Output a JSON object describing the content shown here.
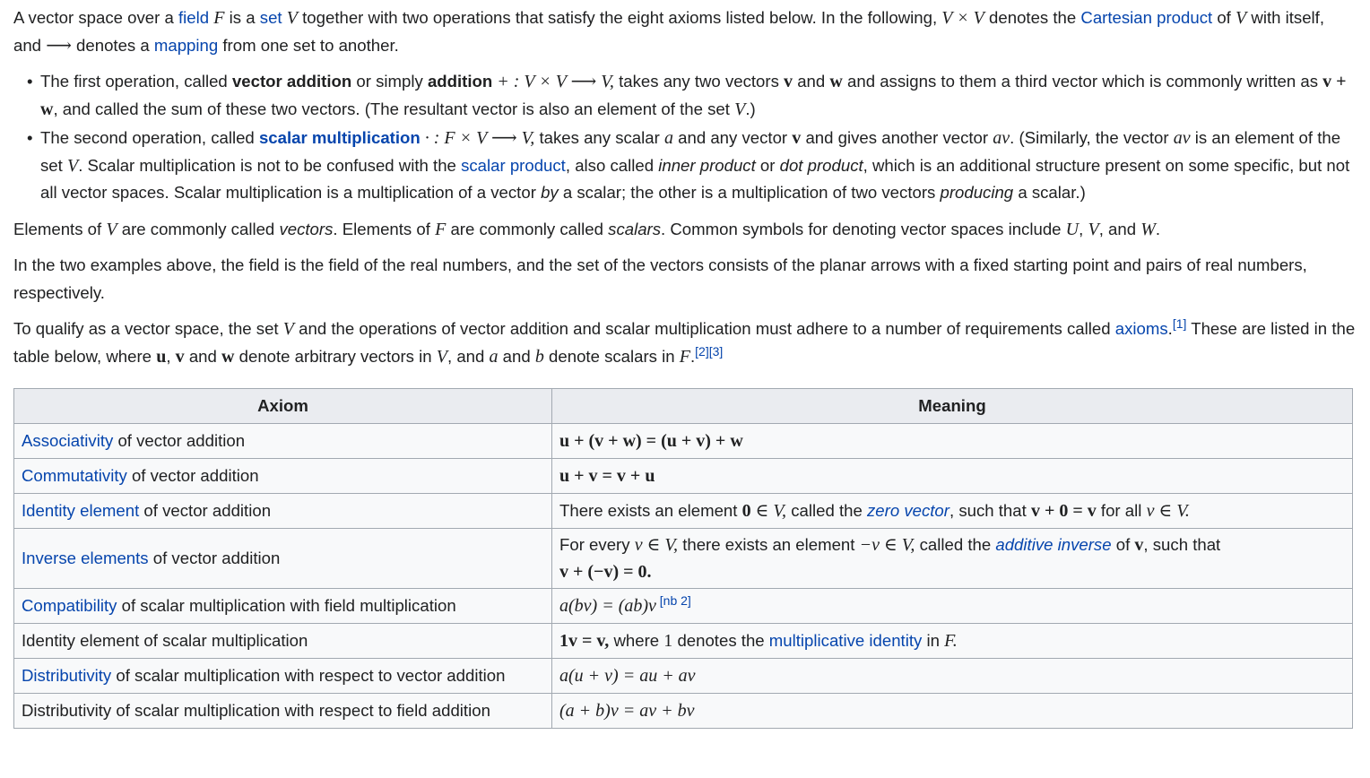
{
  "intro": {
    "t1": "A vector space over a ",
    "field_link": "field",
    "t2": " ",
    "F": "F",
    "t3": " is a ",
    "set_link": "set",
    "t4": " ",
    "V": "V",
    "t5": " together with two operations that satisfy the eight axioms listed below. In the following, ",
    "VxV": "V × V",
    "t6": " denotes the ",
    "cartesian_link": "Cartesian product",
    "t7": " of ",
    "V2": "V",
    "t8": " with itself, and ",
    "arrow": "⟶",
    "t9": " denotes a ",
    "mapping_link": "mapping",
    "t10": " from one set to another."
  },
  "bullets": {
    "first": {
      "t1": "The first operation, called ",
      "bold1": "vector addition",
      "t2": " or simply ",
      "bold2": "addition",
      "math1": " + : V × V ⟶ V,",
      "t3": " takes any two vectors ",
      "v": "v",
      "t4": " and ",
      "w": "w",
      "t5": " and assigns to them a third vector which is commonly written as ",
      "vw": "v + w",
      "t6": ", and called the sum of these two vectors. (The resultant vector is also an element of the set ",
      "V": "V",
      "t7": ".)"
    },
    "second": {
      "t1": "The second operation, called ",
      "bold_link": "scalar multiplication",
      "math1": " · : F × V ⟶ V,",
      "t2": "  takes any scalar ",
      "a": "a",
      "t3": " and any vector ",
      "v": "v",
      "t4": " and gives another vector ",
      "av": "av",
      "t5": ". (Similarly, the vector ",
      "av2": "av",
      "t6": " is an element of the set ",
      "V": "V",
      "t7": ". Scalar multiplication is not to be confused with the ",
      "scalar_product_link": "scalar product",
      "t8": ", also called ",
      "inner": "inner product",
      "t9": " or ",
      "dot": "dot product",
      "t10": ", which is an additional structure present on some specific, but not all vector spaces. Scalar multiplication is a multiplication of a vector ",
      "by": "by",
      "t11": " a scalar; the other is a multiplication of two vectors ",
      "producing": "producing",
      "t12": " a scalar.)"
    }
  },
  "para_elements": {
    "t1": "Elements of ",
    "V": "V",
    "t2": " are commonly called ",
    "vectors": "vectors",
    "t3": ". Elements of ",
    "F": "F",
    "t4": " are commonly called ",
    "scalars": "scalars",
    "t5": ". Common symbols for denoting vector spaces include ",
    "U": "U",
    "t6": ", ",
    "V2": "V",
    "t7": ", and ",
    "W": "W",
    "t8": "."
  },
  "para_examples": {
    "text": "In the two examples above, the field is the field of the real numbers, and the set of the vectors consists of the planar arrows with a fixed starting point and pairs of real numbers, respectively."
  },
  "para_qualify": {
    "t1": "To qualify as a vector space, the set ",
    "V": "V",
    "t2": " and the operations of vector addition and scalar multiplication must adhere to a number of requirements called ",
    "axioms_link": "axioms",
    "t3": ".",
    "ref1": "[1]",
    "t4": " These are listed in the table below, where ",
    "u": "u",
    "t5": ", ",
    "v": "v",
    "t6": " and ",
    "w": "w",
    "t7": " denote arbitrary vectors in ",
    "V2": "V",
    "t8": ", and ",
    "a": "a",
    "t9": " and ",
    "b": "b",
    "t10": " denote scalars in ",
    "F": "F",
    "t11": ".",
    "ref2": "[2][3]"
  },
  "table": {
    "header_axiom": "Axiom",
    "header_meaning": "Meaning",
    "rows": [
      {
        "link": "Associativity",
        "rest": " of vector addition"
      },
      {
        "link": "Commutativity",
        "rest": " of vector addition"
      },
      {
        "link": "Identity element",
        "rest": " of vector addition"
      },
      {
        "link": "Inverse elements",
        "rest": " of vector addition"
      },
      {
        "link": "Compatibility",
        "rest": " of scalar multiplication with field multiplication"
      },
      {
        "link": "",
        "rest": "Identity element of scalar multiplication"
      },
      {
        "link": "Distributivity",
        "rest": " of scalar multiplication with respect to vector addition"
      },
      {
        "link": "",
        "rest": "Distributivity of scalar multiplication with respect to field addition"
      }
    ],
    "meaning": {
      "assoc": "u + (v + w) = (u + v) + w",
      "comm": "u + v = v + u",
      "ident": {
        "t1": "There exists an element ",
        "zero": "0",
        "in1": " ∈ V,",
        "t2": " called the ",
        "link": "zero vector",
        "t3": ", such that ",
        "eq": "v + 0 = v",
        "t4": " for all ",
        "vinV": "v ∈ V.",
        "t5": ""
      },
      "inverse": {
        "t1": "For every ",
        "vinV": "v ∈ V,",
        "t2": " there exists an element ",
        "neg": "−v ∈ V,",
        "t3": " called the ",
        "link": "additive inverse",
        "t4": " of ",
        "v": "v",
        "t5": ", such that ",
        "eq": "v + (−v) = 0.",
        "t6": ""
      },
      "compat": {
        "eq": "a(bv) = (ab)v",
        "note": " [nb 2]"
      },
      "identity_scalar": {
        "eq": "1v = v,",
        "t1": " where ",
        "one": "1",
        "t2": " denotes the ",
        "link": "multiplicative identity",
        "t3": " in ",
        "F": "F.",
        "t4": ""
      },
      "dist_vec": "a(u + v) = au + av",
      "dist_field": "(a + b)v = av + bv"
    }
  }
}
